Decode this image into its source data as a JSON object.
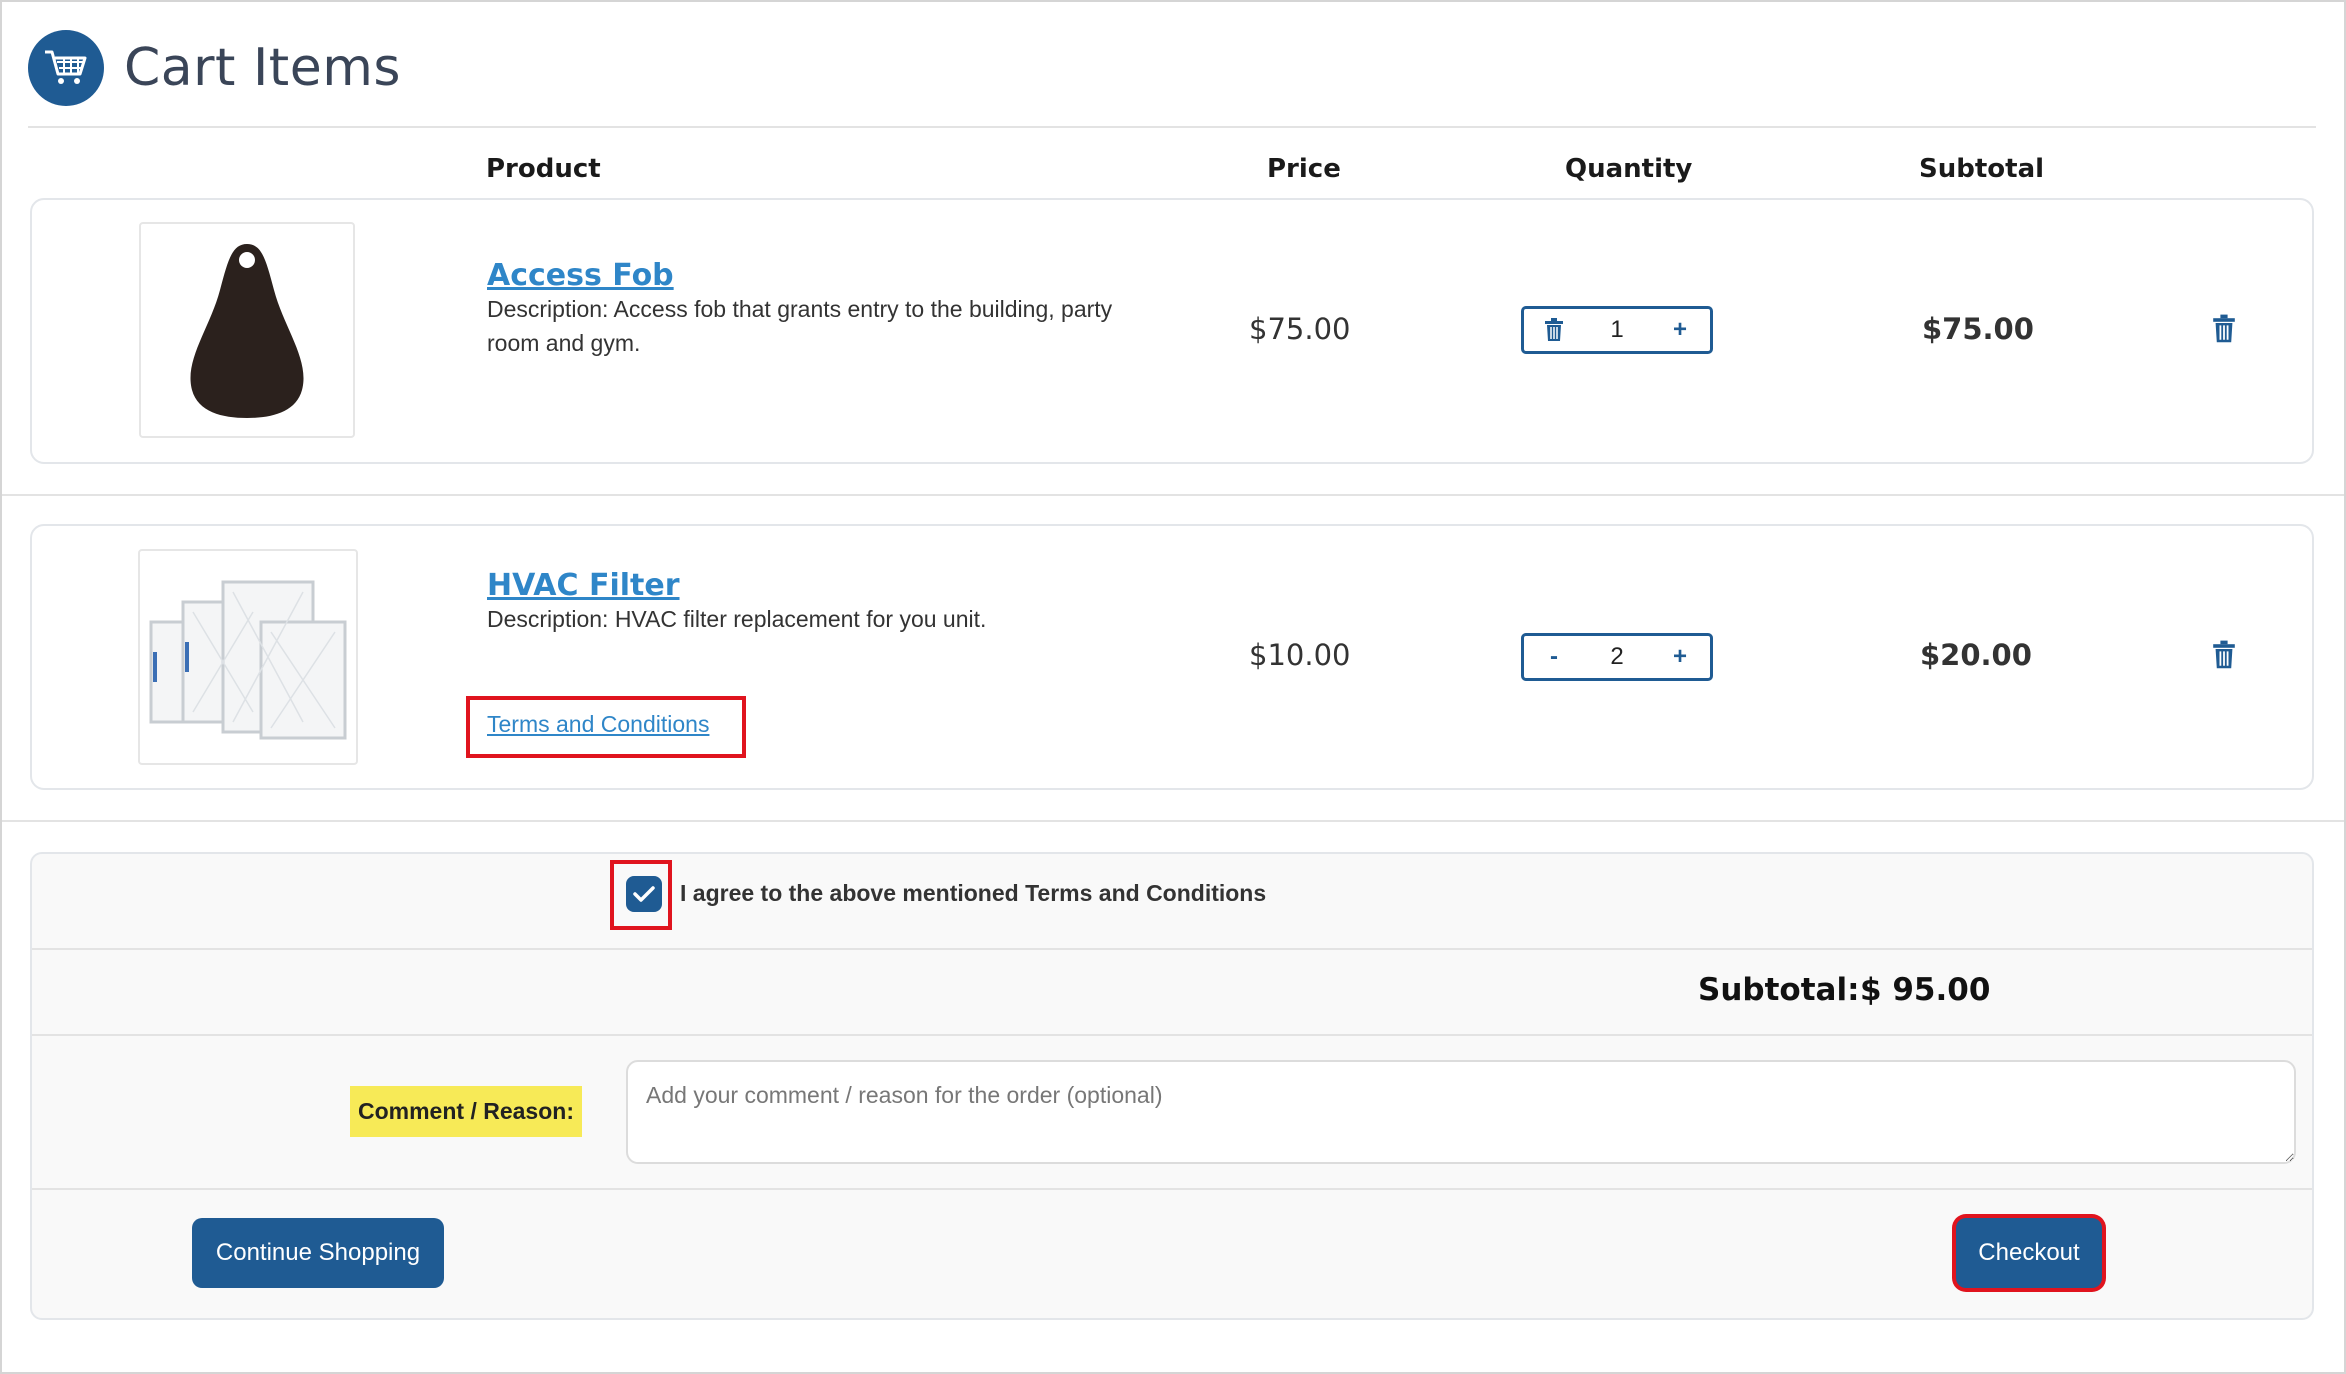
{
  "page": {
    "title": "Cart Items"
  },
  "table": {
    "headers": {
      "product": "Product",
      "price": "Price",
      "quantity": "Quantity",
      "subtotal": "Subtotal"
    }
  },
  "items": [
    {
      "name": "Access Fob",
      "description": "Description: Access fob that grants entry to the building, party room and gym.",
      "price": "$75.00",
      "quantity": "1",
      "decrement_icon": "trash-icon",
      "increment_label": "+",
      "subtotal": "$75.00"
    },
    {
      "name": "HVAC Filter",
      "description": "Description: HVAC filter replacement for you unit.",
      "price": "$10.00",
      "quantity": "2",
      "decrement_label": "-",
      "increment_label": "+",
      "subtotal": "$20.00",
      "terms_link": "Terms and Conditions"
    }
  ],
  "agreement": {
    "label": "I agree to the above mentioned Terms and Conditions",
    "checked": true
  },
  "summary": {
    "subtotal_label": "Subtotal:",
    "subtotal_value": "$ 95.00"
  },
  "comment": {
    "label": "Comment / Reason:",
    "placeholder": "Add your comment / reason for the order (optional)",
    "value": ""
  },
  "actions": {
    "continue_label": "Continue Shopping",
    "checkout_label": "Checkout"
  },
  "colors": {
    "primary": "#1f5b93",
    "link": "#2f86c8",
    "highlight": "#f7ea57",
    "annotation": "#e0141e"
  }
}
